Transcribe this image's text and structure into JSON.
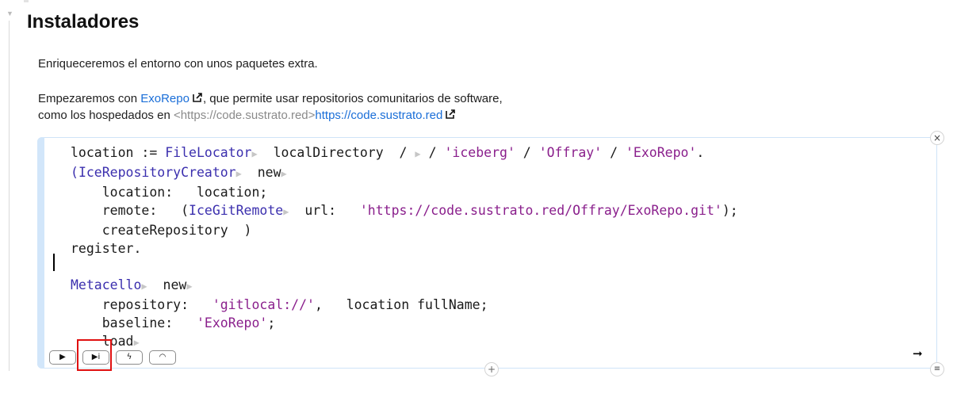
{
  "heading": "Instaladores",
  "intro": "Enriqueceremos el entorno con unos paquetes extra.",
  "para2": {
    "prefix": "Empezaremos con ",
    "link1": "ExoRepo",
    "mid": ", que permite usar repositorios comunitarios de software,",
    "line2_prefix": "como los hospedados en ",
    "url_raw": "<https://code.sustrato.red>",
    "url_link": "https://code.sustrato.red"
  },
  "code": {
    "l1_var": "location := ",
    "l1_cls": "FileLocator",
    "l1_rest": "  localDirectory  / ",
    "l1_s1": "'iceberg'",
    "l1_sep1": " / ",
    "l1_s2": "'Offray'",
    "l1_sep2": " / ",
    "l1_s3": "'ExoRepo'",
    "l1_end": ".",
    "l2_open": "(",
    "l2_cls": "IceRepositoryCreator",
    "l2_rest": "  new",
    "l3": "    location:   location;",
    "l4_kw": "    remote:   (",
    "l4_cls": "IceGitRemote",
    "l4_mid": "  url:   ",
    "l4_str": "'https://code.sustrato.red/Offray/ExoRepo.git'",
    "l4_end": ");",
    "l5": "    createRepository  )",
    "l6": "register.",
    "l8_cls": "Metacello",
    "l8_rest": "  new",
    "l9_kw": "    repository:   ",
    "l9_str": "'gitlocal://'",
    "l9_rest": ",   location fullName;",
    "l10_kw": "    baseline:   ",
    "l10_str": "'ExoRepo'",
    "l10_end": ";",
    "l11": "    load"
  },
  "toolbar": {
    "play": "▶",
    "play_inspect": "▶i",
    "bolt": "ϟ",
    "gauge": "◠"
  },
  "controls": {
    "close": "×",
    "add": "+",
    "menu": "≡",
    "run_arrow": "➞"
  }
}
